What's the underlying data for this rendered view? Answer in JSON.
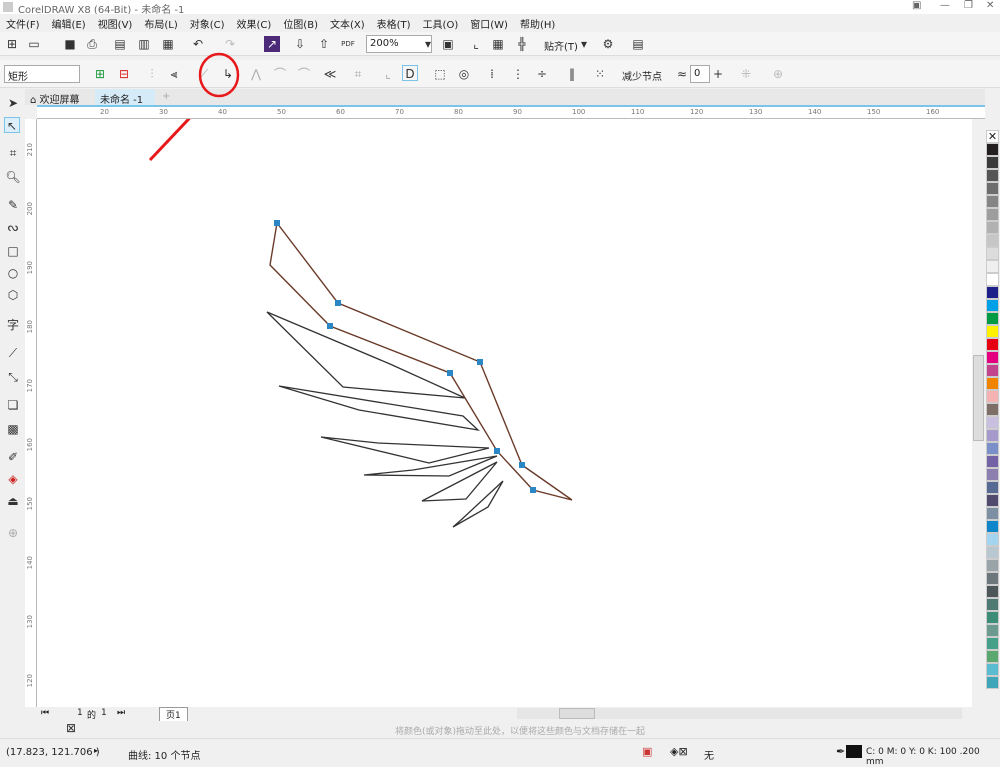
{
  "window": {
    "title": "CorelDRAW X8 (64-Bit) - 未命名 -1"
  },
  "menu": [
    "文件(F)",
    "编辑(E)",
    "视图(V)",
    "布局(L)",
    "对象(C)",
    "效果(C)",
    "位图(B)",
    "文本(X)",
    "表格(T)",
    "工具(O)",
    "窗口(W)",
    "帮助(H)"
  ],
  "toolbar": {
    "zoom": "200%",
    "snap": "贴齐(T)",
    "pdf": "PDF"
  },
  "property_bar": {
    "shape_select": "矩形",
    "reduce_nodes": "减少节点",
    "smoothness": "0"
  },
  "tabs": [
    {
      "label": "欢迎屏幕"
    },
    {
      "label": "未命名 -1"
    }
  ],
  "ruler": {
    "top": [
      "20",
      "30",
      "40",
      "50",
      "60",
      "70",
      "80",
      "90",
      "100",
      "110",
      "120",
      "130",
      "140",
      "150",
      "160"
    ],
    "left": [
      "210",
      "200",
      "190",
      "180",
      "170",
      "160",
      "150",
      "140",
      "130",
      "120"
    ]
  },
  "page_nav": {
    "current": "1",
    "of": "的",
    "total": "1",
    "page_tab": "页1"
  },
  "color_hint": "将颜色(或对象)拖动至此处，以便将这些颜色与文档存储在一起",
  "status": {
    "coords": "(17.823, 121.706 )",
    "object_info": "曲线: 10 个节点",
    "fill": "无",
    "outline": "C: 0 M: 0 Y: 0 K: 100  .200 mm"
  },
  "palette": [
    "#231f20",
    "#3a3a3a",
    "#555555",
    "#6d6d6d",
    "#858585",
    "#9d9d9d",
    "#b1b1b1",
    "#c6c6c6",
    "#dcdcdc",
    "#efefef",
    "#ffffff",
    "#1d2088",
    "#00a0e9",
    "#009944",
    "#fff100",
    "#e60012",
    "#e4007f",
    "#c2448c",
    "#f08300",
    "#f5b2b2",
    "#7d6e67",
    "#c9c0e0",
    "#a59acb",
    "#7b8fc9",
    "#7362a6",
    "#8c7fb0",
    "#566a94",
    "#4f4a6e",
    "#7d8fa3",
    "#0f86c9",
    "#a3d5f0",
    "#b8c7d0",
    "#9aa3a8",
    "#6d767a",
    "#4d5659",
    "#4f7a74",
    "#3d8c78",
    "#6d9a8e",
    "#45a08a",
    "#5aa870",
    "#5abcd0",
    "#3fa5b8"
  ],
  "annotation_color": "#e8191a"
}
